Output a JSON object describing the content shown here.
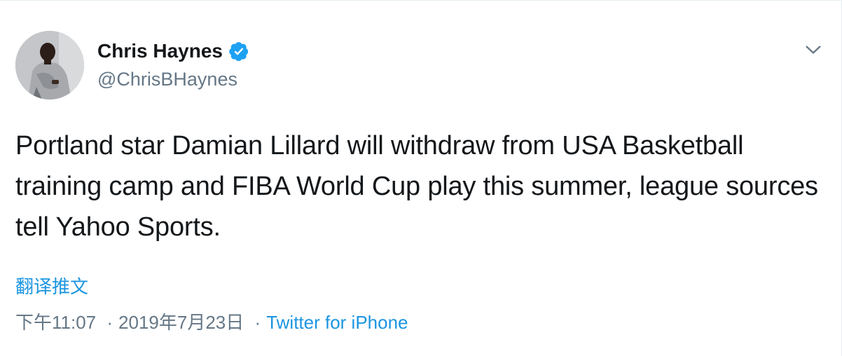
{
  "author": {
    "name": "Chris Haynes",
    "handle": "@ChrisBHaynes",
    "verified_icon": "verified-badge-icon"
  },
  "tweet": {
    "text": "Portland star Damian Lillard will withdraw from USA Basketball training camp and FIBA World Cup play this summer, league sources tell Yahoo Sports."
  },
  "translate_label": "翻译推文",
  "meta": {
    "time": "下午11:07",
    "separator": "·",
    "date": "2019年7月23日",
    "source": "Twitter for iPhone"
  },
  "menu_icon": "chevron-down-icon",
  "colors": {
    "link": "#1b95e0",
    "secondary_text": "#657786",
    "primary_text": "#14171a",
    "verified": "#1da1f2"
  }
}
